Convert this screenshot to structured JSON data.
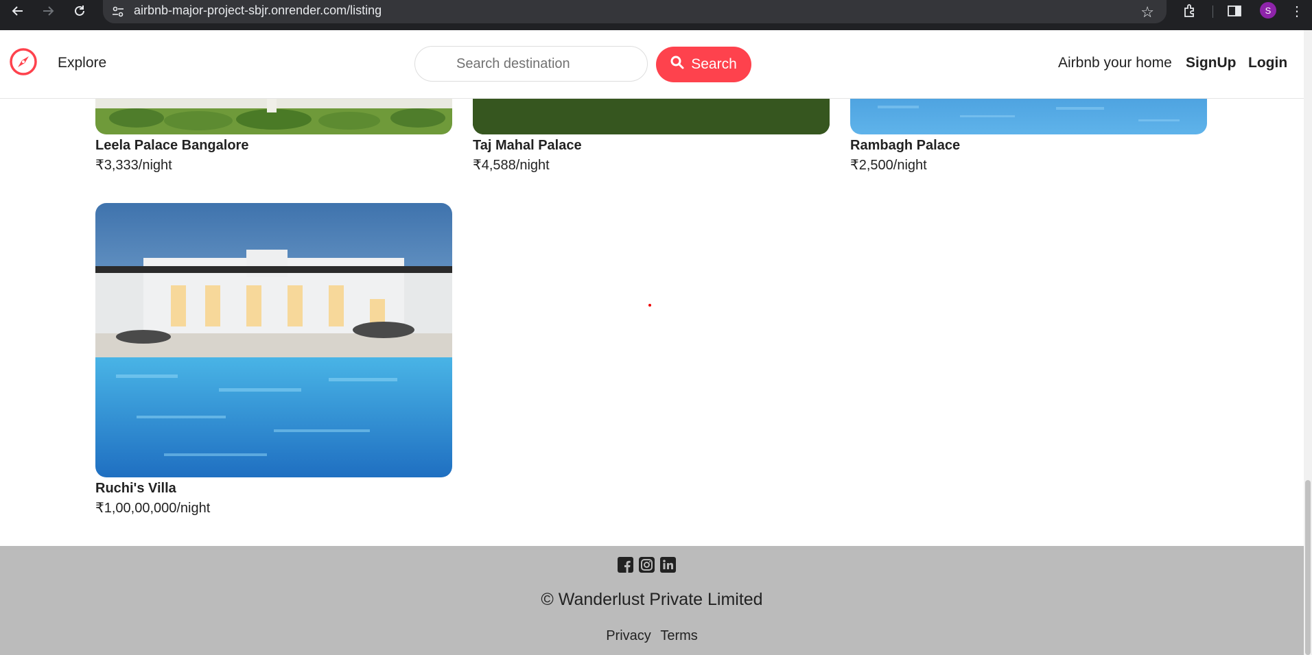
{
  "browser": {
    "url": "airbnb-major-project-sbjr.onrender.com/listing",
    "profile_initial": "S"
  },
  "navbar": {
    "explore_label": "Explore",
    "search_placeholder": "Search destination",
    "search_button_label": "Search",
    "host_link": "Airbnb your home",
    "signup_label": "SignUp",
    "login_label": "Login",
    "brand_color": "#fe424d"
  },
  "listings": [
    {
      "title": "Leela Palace Bangalore",
      "price": "₹3,333/night"
    },
    {
      "title": "Taj Mahal Palace",
      "price": "₹4,588/night"
    },
    {
      "title": "Rambagh Palace",
      "price": "₹2,500/night"
    },
    {
      "title": "Ruchi's Villa",
      "price": "₹1,00,00,000/night"
    }
  ],
  "footer": {
    "social_icons": [
      "facebook-icon",
      "instagram-icon",
      "linkedin-icon"
    ],
    "copyright": "© Wanderlust Private Limited",
    "privacy_label": "Privacy",
    "terms_label": "Terms"
  }
}
